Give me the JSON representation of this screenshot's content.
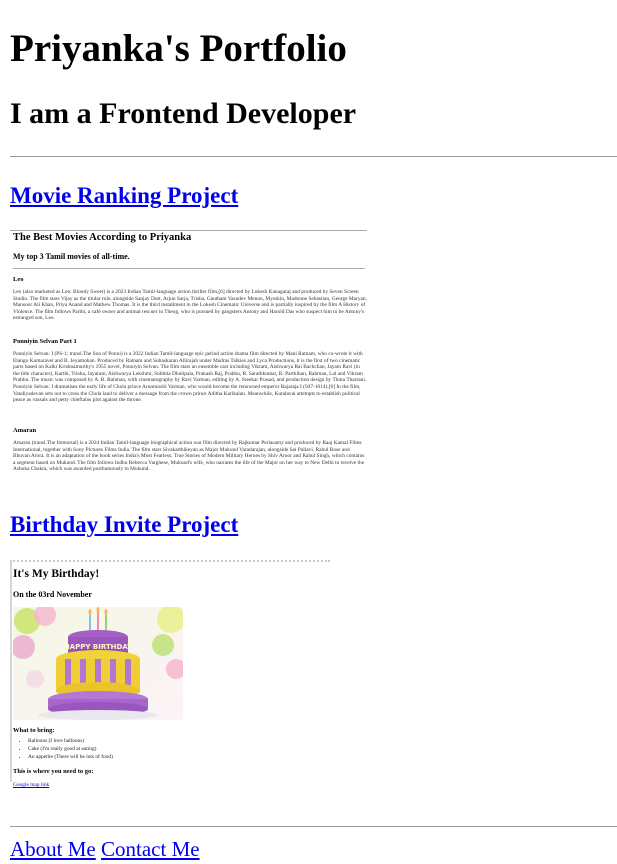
{
  "header": {
    "title": "Priyanka's Portfolio",
    "subtitle": "I am a Frontend Developer"
  },
  "projects": {
    "movie_link": "Movie Ranking Project",
    "birthday_link": "Birthday Invite Project"
  },
  "movie_page": {
    "title": "The Best Movies According to Priyanka",
    "subtitle": "My top 3 Tamil movies of all-time.",
    "movies": [
      {
        "name": "Leo",
        "description": "Leo (also marketed as Leo: Bloody Sweet) is a 2023 Indian Tamil-language action thriller film,[6] directed by Lokesh Kanagaraj and produced by Seven Screen Studio. The film stars Vijay as the titular role, alongside Sanjay Dutt, Arjun Sarja, Trisha, Gautham Vasudev Menon, Mysskin, Madonne Sebastian, George Maryan, Mansoor Ali Khan, Priya Anand and Mathew Thomas. It is the third installment in the Lokesh Cinematic Universe and is partially inspired by the film A History of Violence. The film follows Parthi, a café owner and animal rescuer in Theog, who is pursued by gangsters Antony and Harold Das who suspect him to be Antony's estranged son, Leo."
      },
      {
        "name": "Ponniyin Selvan Part 1",
        "description": "Ponniyin Selvan: I (PS-1; transl.The Son of Ponni) is a 2022 Indian Tamil-language epic period action drama film directed by Mani Ratnam, who co-wrote it with Elango Kumaravel and B. Jeyamohan. Produced by Ratnam and Subaskaran Allirajah under Madras Talkies and Lyca Productions, it is the first of two cinematic parts based on Kalki Krishnamurthy's 1955 novel, Ponniyin Selvan. The film stars an ensemble cast including Vikram, Aishwarya Rai Bachchan, Jayam Ravi (in the title character), Karthi, Trisha, Jayaram, Aishwarya Lekshmi, Sobhita Dhulipala, Prakash Raj, Prabhu, R. Sarathkumar, R. Parthiban, Rahman, Lal and Vikram Prabhu. The music was composed by A. R. Rahman, with cinematography by Ravi Varman, editing by A. Sreekar Prasad, and production design by Thota Tharrani. Ponniyin Selvan: I dramatises the early life of Chola prince Arunmozhi Varman, who would become the renowned emperor Rajaraja I (947-1014).[6] In the film, Vandiyadevan sets out to cross the Chola land to deliver a message from the crown prince Aditha Karikalan. Meanwhile, Kundavai attempts to establish political peace as vassals and petty chieftains plot against the throne."
      },
      {
        "name": "Amaran",
        "description": "Amaran (transl.The Immortal) is a 2024 Indian Tamil-language biographical action war film directed by Rajkumar Periasamy and produced by Raaj Kamal Films International, together with Sony Pictures Films India. The film stars Sivakarthikeyan as Major Mukund Varadarajan, alongside Sai Pallavi, Rahul Bose and Bhuvan Arora. It is an adaptation of the book series India's Most Fearless: True Stories of Modern Military Heroes by Shiv Aroor and Rahul Singh, which contains a segment based on Mukund. The film follows Indhu Rebecca Varghese, Mukund's wife, who narrates the life of the Major on her way to New Delhi to receive the Ashoka Chakra, which was awarded posthumously to Mukund."
      }
    ]
  },
  "birthday_page": {
    "title": "It's My Birthday!",
    "date": "On the 03rd November",
    "cake_text": "HAPPY BIRTHDAY",
    "bring_heading": "What to bring:",
    "bring_items": [
      "Balloons (I love balloons)",
      "Cake (I'm really good at eating)",
      "An appetite (There will be lots of food)"
    ],
    "where_heading": "This is where you need to go:",
    "map_link": "Google map link"
  },
  "footer": {
    "about": "About Me",
    "contact": "Contact Me"
  },
  "colors": {
    "link": "#0000ee",
    "rule": "#9a9a9a",
    "cake_top": "#a35fc4",
    "cake_side": "#f2d23a"
  }
}
